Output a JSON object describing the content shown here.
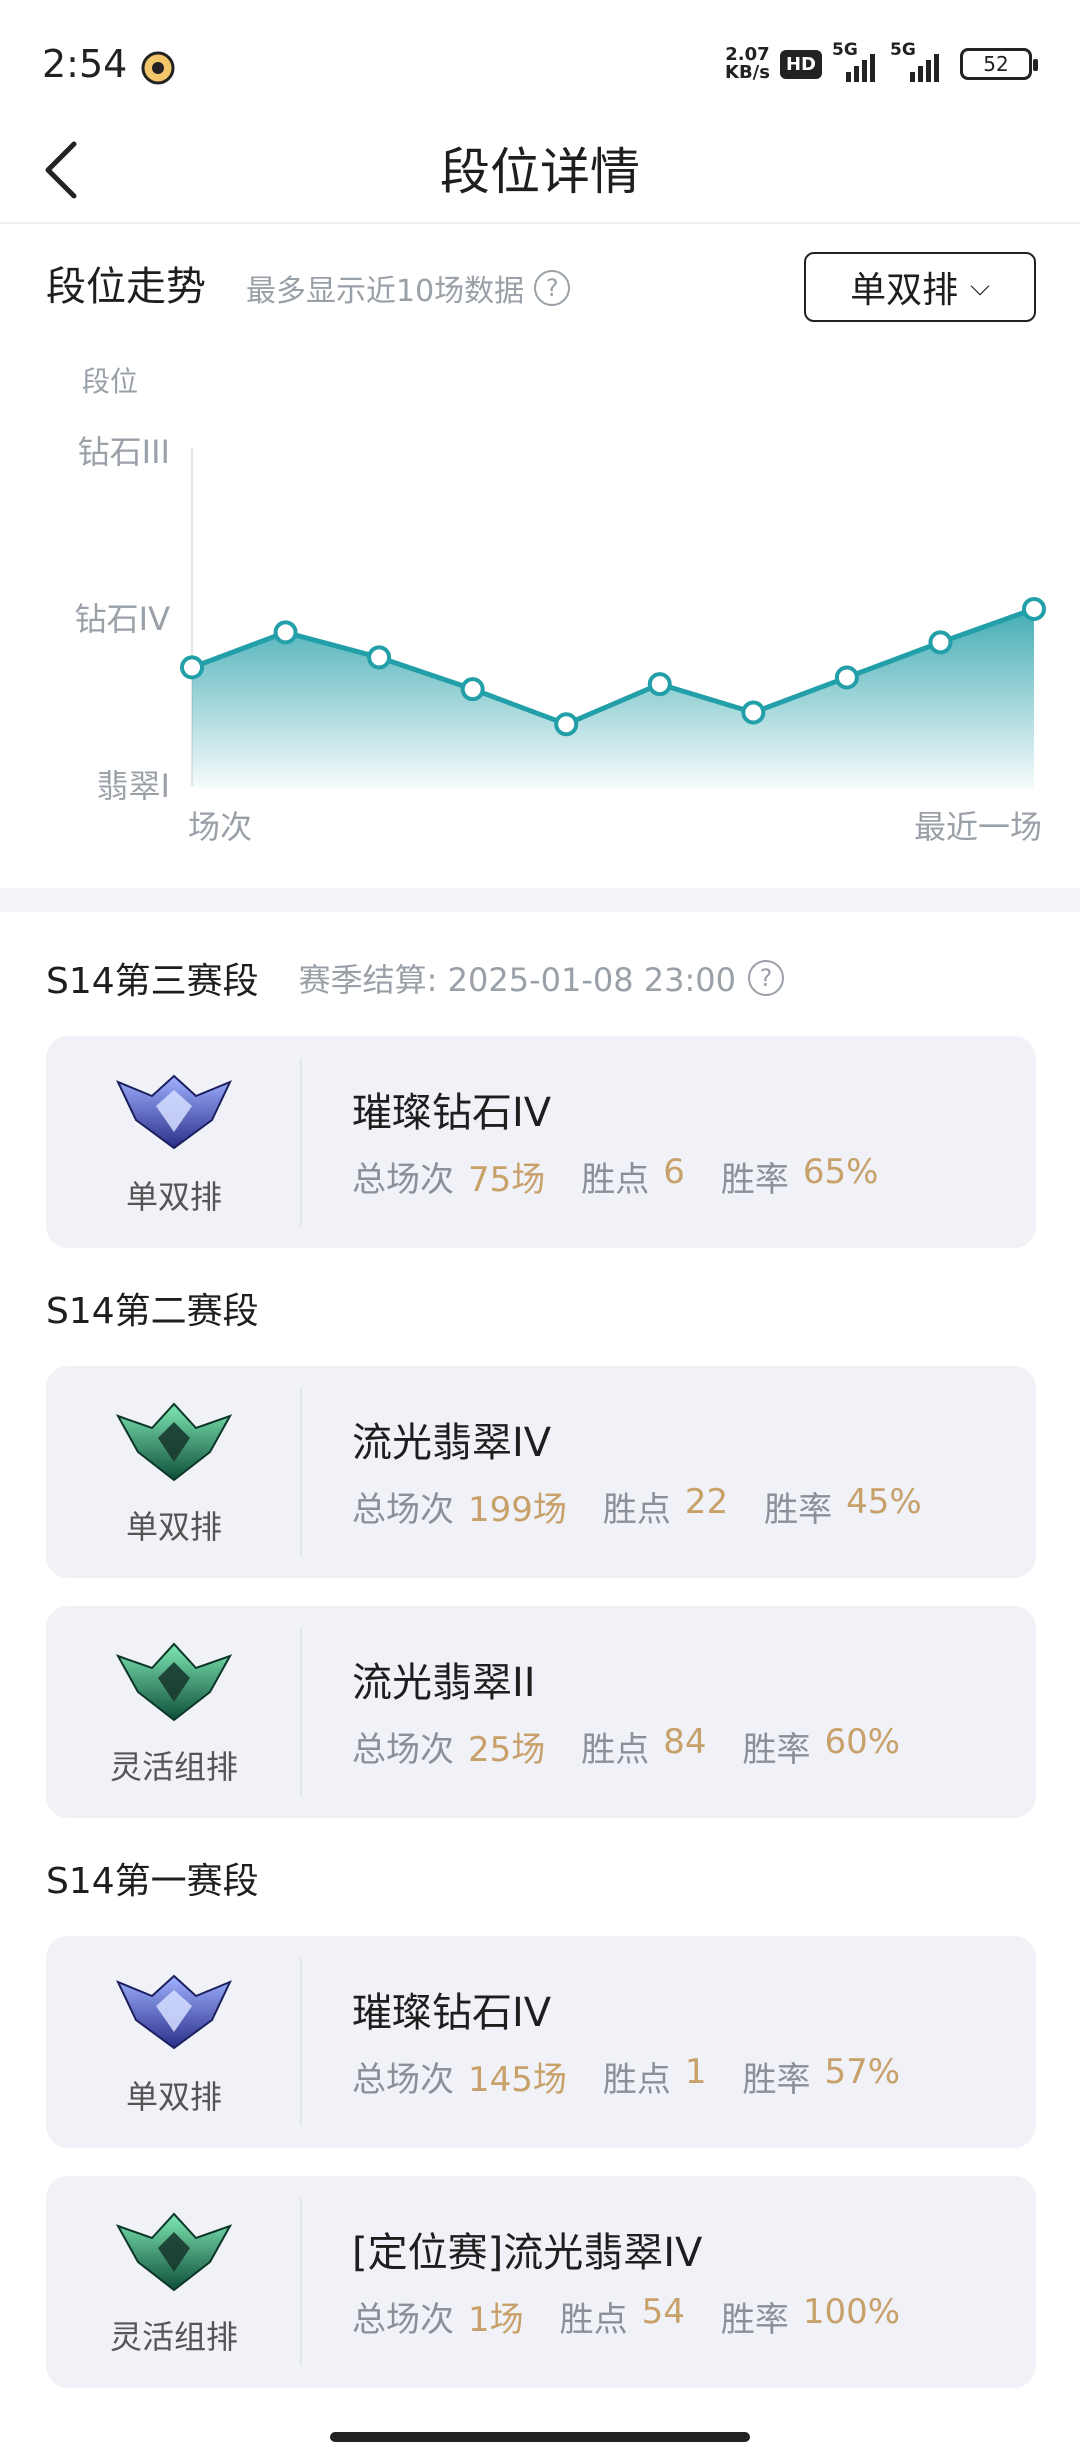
{
  "status_bar": {
    "time": "2:54",
    "net_speed_value": "2.07",
    "net_speed_unit": "KB/s",
    "hd_badge": "HD",
    "signal1_label": "5G",
    "signal2_label": "5G",
    "battery": "52"
  },
  "header": {
    "title": "段位详情"
  },
  "trend": {
    "title": "段位走势",
    "subtitle": "最多显示近10场数据",
    "help_glyph": "?",
    "mode_select": "单双排",
    "chevron_glyph": "⌵"
  },
  "chart_data": {
    "type": "area",
    "ylabel": "段位",
    "y_ticks": [
      "钻石III",
      "钻石IV",
      "翡翠I"
    ],
    "x_start_label": "场次",
    "x_end_label": "最近一场",
    "values": [
      -0.29,
      -0.08,
      -0.23,
      -0.42,
      -0.63,
      -0.39,
      -0.56,
      -0.35,
      -0.14,
      0.06
    ],
    "ylim": [
      -1,
      1
    ],
    "color": "#229fa8"
  },
  "seasons": [
    {
      "title": "S14第三赛段",
      "settle": "赛季结算: 2025-01-08 23:00",
      "cards": [
        {
          "emblem": "diamond-emblem",
          "queue": "单双排",
          "tier": "璀璨钻石IV",
          "k1": "总场次",
          "v1": "75场",
          "k2": "胜点",
          "v2": "6",
          "k3": "胜率",
          "v3": "65%"
        }
      ]
    },
    {
      "title": "S14第二赛段",
      "cards": [
        {
          "emblem": "emerald-emblem",
          "queue": "单双排",
          "tier": "流光翡翠IV",
          "k1": "总场次",
          "v1": "199场",
          "k2": "胜点",
          "v2": "22",
          "k3": "胜率",
          "v3": "45%"
        },
        {
          "emblem": "emerald-emblem",
          "queue": "灵活组排",
          "tier": "流光翡翠II",
          "k1": "总场次",
          "v1": "25场",
          "k2": "胜点",
          "v2": "84",
          "k3": "胜率",
          "v3": "60%"
        }
      ]
    },
    {
      "title": "S14第一赛段",
      "cards": [
        {
          "emblem": "diamond-emblem",
          "queue": "单双排",
          "tier": "璀璨钻石IV",
          "k1": "总场次",
          "v1": "145场",
          "k2": "胜点",
          "v2": "1",
          "k3": "胜率",
          "v3": "57%"
        },
        {
          "emblem": "emerald-emblem",
          "queue": "灵活组排",
          "tier": "[定位赛]流光翡翠IV",
          "k1": "总场次",
          "v1": "1场",
          "k2": "胜点",
          "v2": "54",
          "k3": "胜率",
          "v3": "100%"
        }
      ]
    }
  ]
}
